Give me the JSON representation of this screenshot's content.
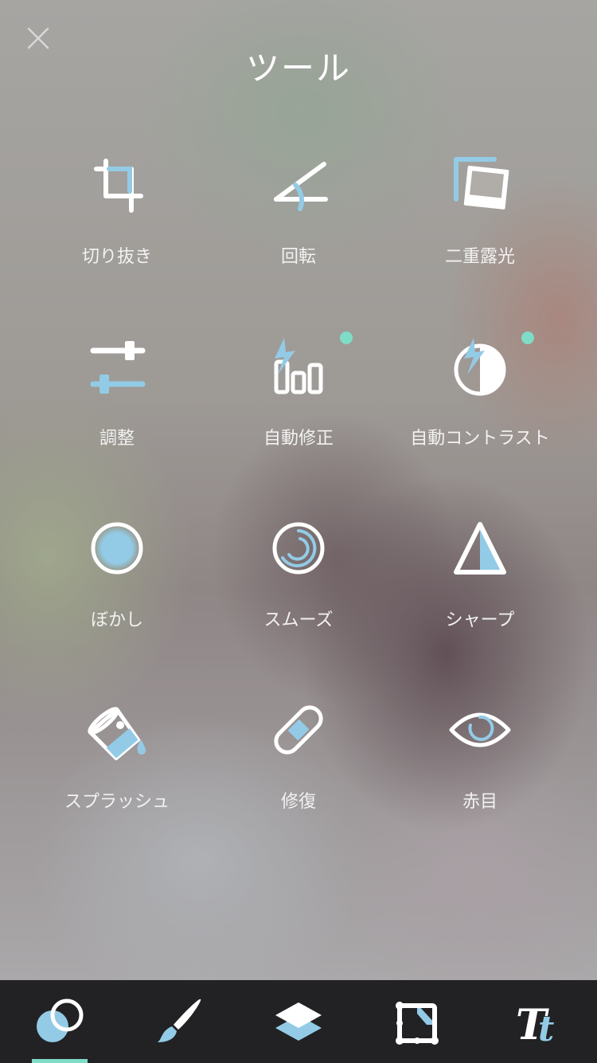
{
  "header": {
    "title": "ツール",
    "close_icon": "close-icon"
  },
  "tools": [
    {
      "label": "切り抜き",
      "icon": "crop-icon"
    },
    {
      "label": "回転",
      "icon": "rotate-icon"
    },
    {
      "label": "二重露光",
      "icon": "double-exposure-icon"
    },
    {
      "label": "調整",
      "icon": "adjust-icon"
    },
    {
      "label": "自動修正",
      "icon": "auto-fix-icon",
      "new_badge": true
    },
    {
      "label": "自動コントラスト",
      "icon": "auto-contrast-icon",
      "new_badge": true
    },
    {
      "label": "ぼかし",
      "icon": "blur-icon"
    },
    {
      "label": "スムーズ",
      "icon": "smooth-icon"
    },
    {
      "label": "シャープ",
      "icon": "sharpen-icon"
    },
    {
      "label": "スプラッシュ",
      "icon": "splash-icon"
    },
    {
      "label": "修復",
      "icon": "heal-icon"
    },
    {
      "label": "赤目",
      "icon": "red-eye-icon"
    }
  ],
  "bottom_nav": {
    "items": [
      {
        "icon": "effects-icon",
        "selected": true
      },
      {
        "icon": "brush-icon",
        "selected": false
      },
      {
        "icon": "layers-icon",
        "selected": false
      },
      {
        "icon": "shape-crop-icon",
        "selected": false
      },
      {
        "icon": "text-icon",
        "selected": false
      }
    ]
  },
  "colors": {
    "accent_blue": "#93cbe6",
    "new_badge": "#7fdcc6",
    "nav_bg": "#222224",
    "icon_white": "#ffffff"
  }
}
